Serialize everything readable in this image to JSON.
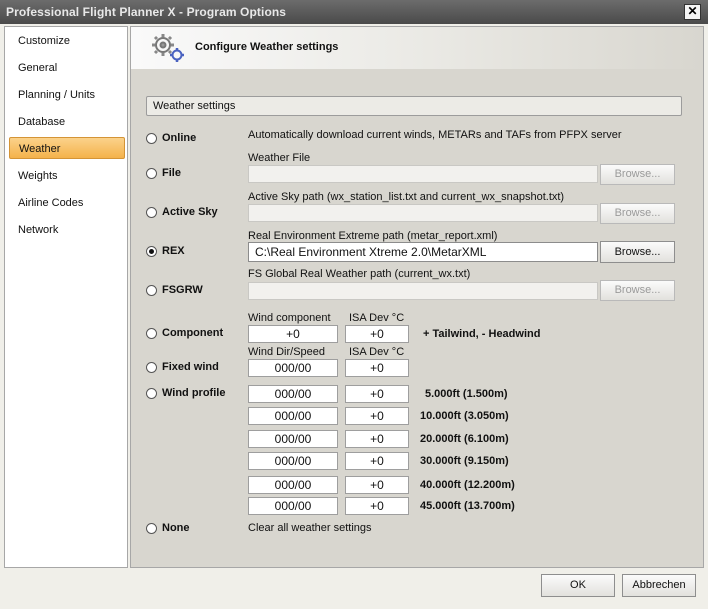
{
  "window": {
    "title": "Professional Flight Planner X - Program Options",
    "close_label": "✕"
  },
  "sidebar": {
    "items": [
      "Customize",
      "General",
      "Planning / Units",
      "Database",
      "Weather",
      "Weights",
      "Airline Codes",
      "Network"
    ]
  },
  "header": {
    "title": "Configure Weather settings",
    "icon": "gears-icon"
  },
  "group": {
    "label": "Weather settings"
  },
  "options": {
    "online": {
      "label": "Online",
      "desc": "Automatically download current winds, METARs and TAFs from PFPX server"
    },
    "file": {
      "label": "File",
      "caption": "Weather File",
      "value": "",
      "browse": "Browse..."
    },
    "activesky": {
      "label": "Active Sky",
      "caption": "Active Sky path (wx_station_list.txt and current_wx_snapshot.txt)",
      "value": "",
      "browse": "Browse..."
    },
    "rex": {
      "label": "REX",
      "caption": "Real Environment Extreme path (metar_report.xml)",
      "value": "C:\\Real Environment Xtreme 2.0\\MetarXML",
      "browse": "Browse...",
      "selected": true
    },
    "fsgrw": {
      "label": "FSGRW",
      "caption": "FS Global Real Weather path (current_wx.txt)",
      "value": "",
      "browse": "Browse..."
    },
    "component": {
      "label": "Component",
      "wind_caption": "Wind component",
      "isa_caption": "ISA Dev °C",
      "wind": "+0",
      "isa": "+0",
      "hint": "+ Tailwind,  - Headwind"
    },
    "fixedwind": {
      "label": "Fixed wind",
      "wind_caption": "Wind Dir/Speed",
      "isa_caption": "ISA Dev °C",
      "wind": "000/00",
      "isa": "+0"
    },
    "windprofile": {
      "label": "Wind profile",
      "rows": [
        {
          "wind": "000/00",
          "isa": "+0",
          "alt": "5.000ft (1.500m)"
        },
        {
          "wind": "000/00",
          "isa": "+0",
          "alt": "10.000ft (3.050m)"
        },
        {
          "wind": "000/00",
          "isa": "+0",
          "alt": "20.000ft (6.100m)"
        },
        {
          "wind": "000/00",
          "isa": "+0",
          "alt": "30.000ft (9.150m)"
        },
        {
          "wind": "000/00",
          "isa": "+0",
          "alt": "40.000ft (12.200m)"
        },
        {
          "wind": "000/00",
          "isa": "+0",
          "alt": "45.000ft (13.700m)"
        }
      ]
    },
    "none": {
      "label": "None",
      "desc": "Clear all weather settings"
    }
  },
  "footer": {
    "ok": "OK",
    "cancel": "Abbrechen"
  }
}
